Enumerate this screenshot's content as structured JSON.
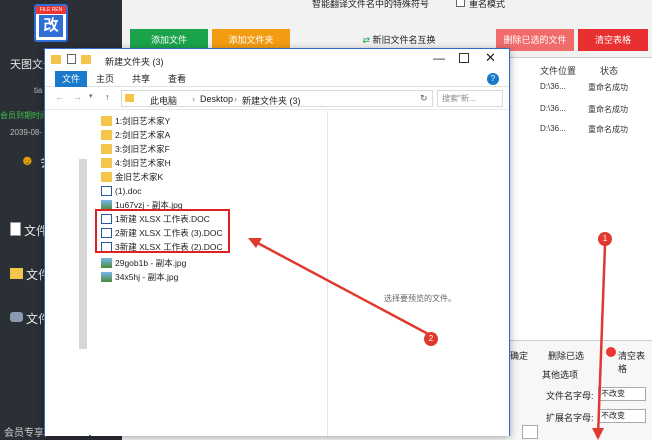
{
  "sidebar": {
    "title_partial": "天图文件",
    "subtitle_partial": "tia",
    "member_partial": "会员到期时间",
    "date_partial": "2039-08-",
    "user_partial": "会",
    "nav": [
      {
        "label": "文件名",
        "icon": "doc-icon"
      },
      {
        "label": "文件夹",
        "icon": "folder-icon"
      },
      {
        "label": "文件",
        "icon": "gamepad-icon"
      }
    ],
    "footer_partial": "会员专享,",
    "logo_top": "FILE REN",
    "logo_char": "改"
  },
  "topbar": {
    "checkbox1_label": "智能翻译文件名中的特殊符号",
    "checkbox2_label": "重名模式",
    "buttons": [
      {
        "label": "添加文件",
        "color": "#1aa34a"
      },
      {
        "label": "添加文件夹",
        "color": "#f39c12"
      },
      {
        "label": "新旧文件名互换",
        "color": "#f2f2f2"
      },
      {
        "label": "删除已选的文件",
        "color": "#f26b6b"
      },
      {
        "label": "清空表格",
        "color": "#e83030"
      }
    ]
  },
  "right_table": {
    "headers": [
      "文件位置",
      "状态"
    ],
    "rows": [
      {
        "loc": "D:\\36...",
        "status": "重命名成功"
      },
      {
        "loc": "D:\\36...",
        "status": "重命名成功"
      },
      {
        "loc": "D:\\36...",
        "status": "重命名成功"
      }
    ]
  },
  "bottom": {
    "confirm": "确定",
    "delete_selected": "删除已选",
    "clear_table": "清空表格",
    "options_title": "其他选项",
    "name_case_label": "文件名字母:",
    "name_case_value": "不改变",
    "ext_case_label": "扩展名字母:",
    "ext_case_value": "不改变"
  },
  "explorer": {
    "title": "新建文件夹 (3)",
    "ribbon": [
      "文件",
      "主页",
      "共享",
      "查看"
    ],
    "path": [
      "此电脑",
      "Desktop",
      "新建文件夹 (3)"
    ],
    "search_placeholder": "搜索\"新...",
    "preview_text": "选择要预览的文件。",
    "files": [
      {
        "name": "1:剑旧艺术家Y",
        "type": "folder"
      },
      {
        "name": "2:剑旧艺术家A",
        "type": "folder"
      },
      {
        "name": "3:剑旧艺术家F",
        "type": "folder"
      },
      {
        "name": "4:剑旧艺术家H",
        "type": "folder"
      },
      {
        "name": "金旧艺术家K",
        "type": "folder"
      },
      {
        "name": "(1).doc",
        "type": "doc"
      },
      {
        "name": "1u67vzj - 副本.jpg",
        "type": "img"
      },
      {
        "name": "1新建 XLSX 工作表.DOC",
        "type": "doc"
      },
      {
        "name": "2新建 XLSX 工作表 (3).DOC",
        "type": "doc"
      },
      {
        "name": "3新建 XLSX 工作表 (2).DOC",
        "type": "doc"
      },
      {
        "name": "29gob1b - 副本.jpg",
        "type": "img"
      },
      {
        "name": "34x5hj - 副本.jpg",
        "type": "img"
      }
    ]
  },
  "annotations": {
    "circle1": "1",
    "circle2": "2"
  }
}
